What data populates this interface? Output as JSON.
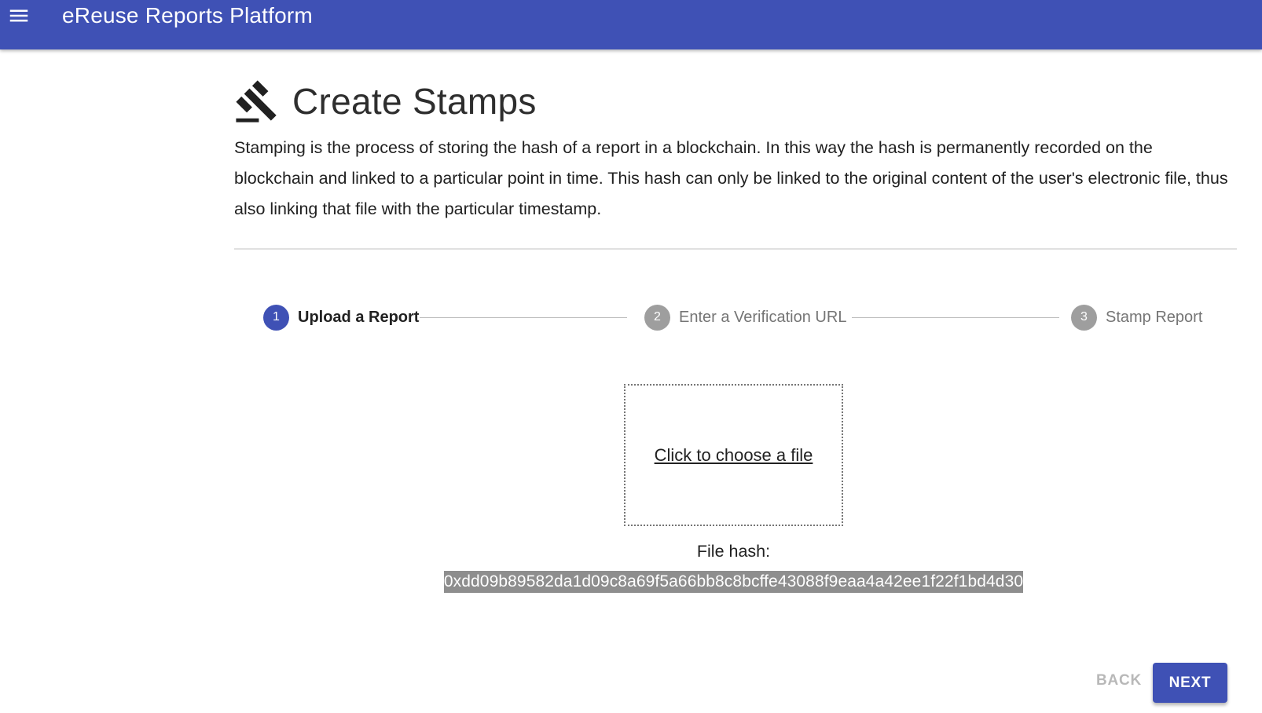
{
  "app_bar": {
    "title": "eReuse Reports Platform",
    "menu_icon": "menu-icon",
    "background_color": "#3f51b5"
  },
  "page": {
    "icon": "gavel-icon",
    "title": "Create Stamps",
    "description": "Stamping is the process of storing the hash of a report in a blockchain. In this way the hash is permanently recorded on the blockchain and linked to a particular point in time. This hash can only be linked to the original content of the user's electronic file, thus also linking that file with the particular timestamp."
  },
  "stepper": {
    "steps": [
      {
        "number": "1",
        "label": "Upload a Report",
        "state": "active"
      },
      {
        "number": "2",
        "label": "Enter a Verification URL",
        "state": "inactive"
      },
      {
        "number": "3",
        "label": "Stamp Report",
        "state": "inactive"
      }
    ]
  },
  "upload": {
    "link_text": "Click to choose a file",
    "hash_label": "File hash:",
    "hash_value": "0xdd09b89582da1d09c8a69f5a66bb8c8bcffe43088f9eaa4a42ee1f22f1bd4d30"
  },
  "actions": {
    "back_label": "BACK",
    "next_label": "NEXT",
    "accent_color": "#3f51b5"
  }
}
